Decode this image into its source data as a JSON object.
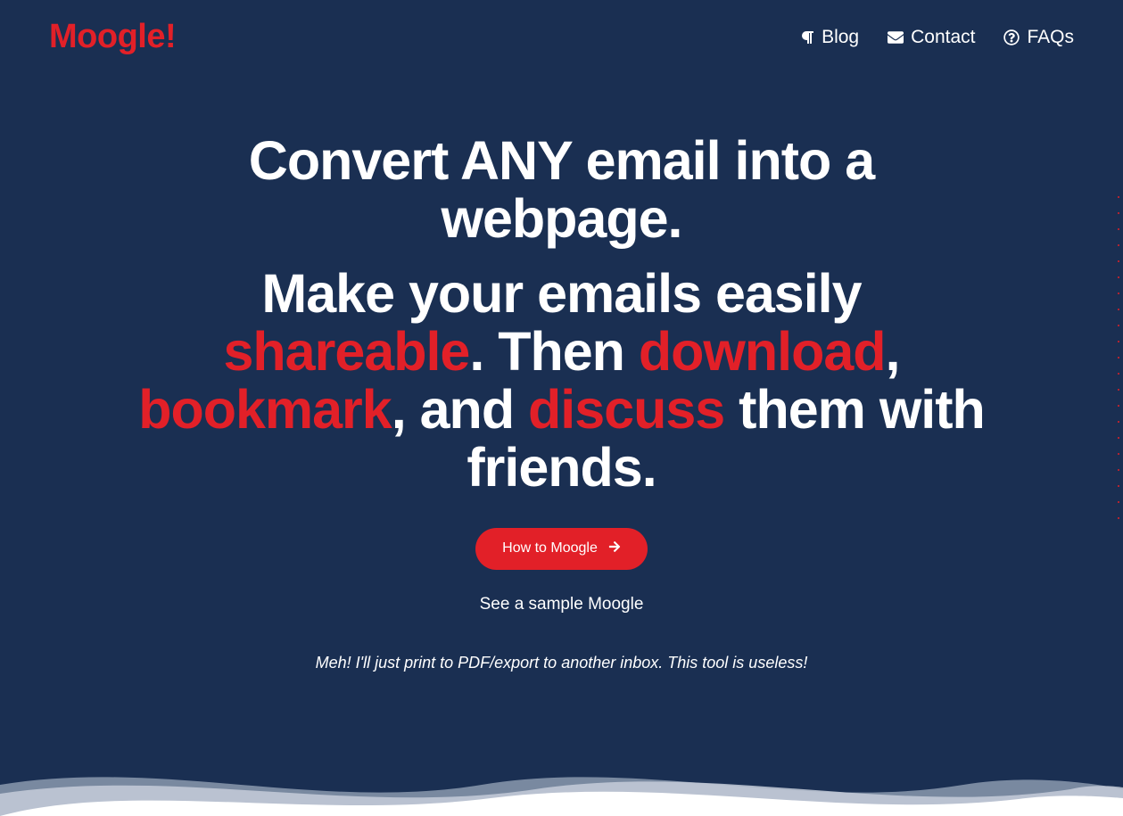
{
  "header": {
    "logo": "Moogle!",
    "nav": {
      "blog": "Blog",
      "contact": "Contact",
      "faqs": "FAQs"
    }
  },
  "hero": {
    "line1": "Convert ANY email into a webpage.",
    "segment2_pre": "Make your emails easily ",
    "keyword_shareable": "shareable",
    "segment2_mid1": ". Then ",
    "keyword_download": "download",
    "segment2_mid2": ", ",
    "keyword_bookmark": "bookmark",
    "segment2_mid3": ", and ",
    "keyword_discuss": "discuss",
    "segment2_end": " them with friends.",
    "cta_label": "How to Moogle",
    "sample_label": "See a sample Moogle",
    "quote": "Meh! I'll just print to PDF/export to another inbox. This tool is useless!"
  }
}
